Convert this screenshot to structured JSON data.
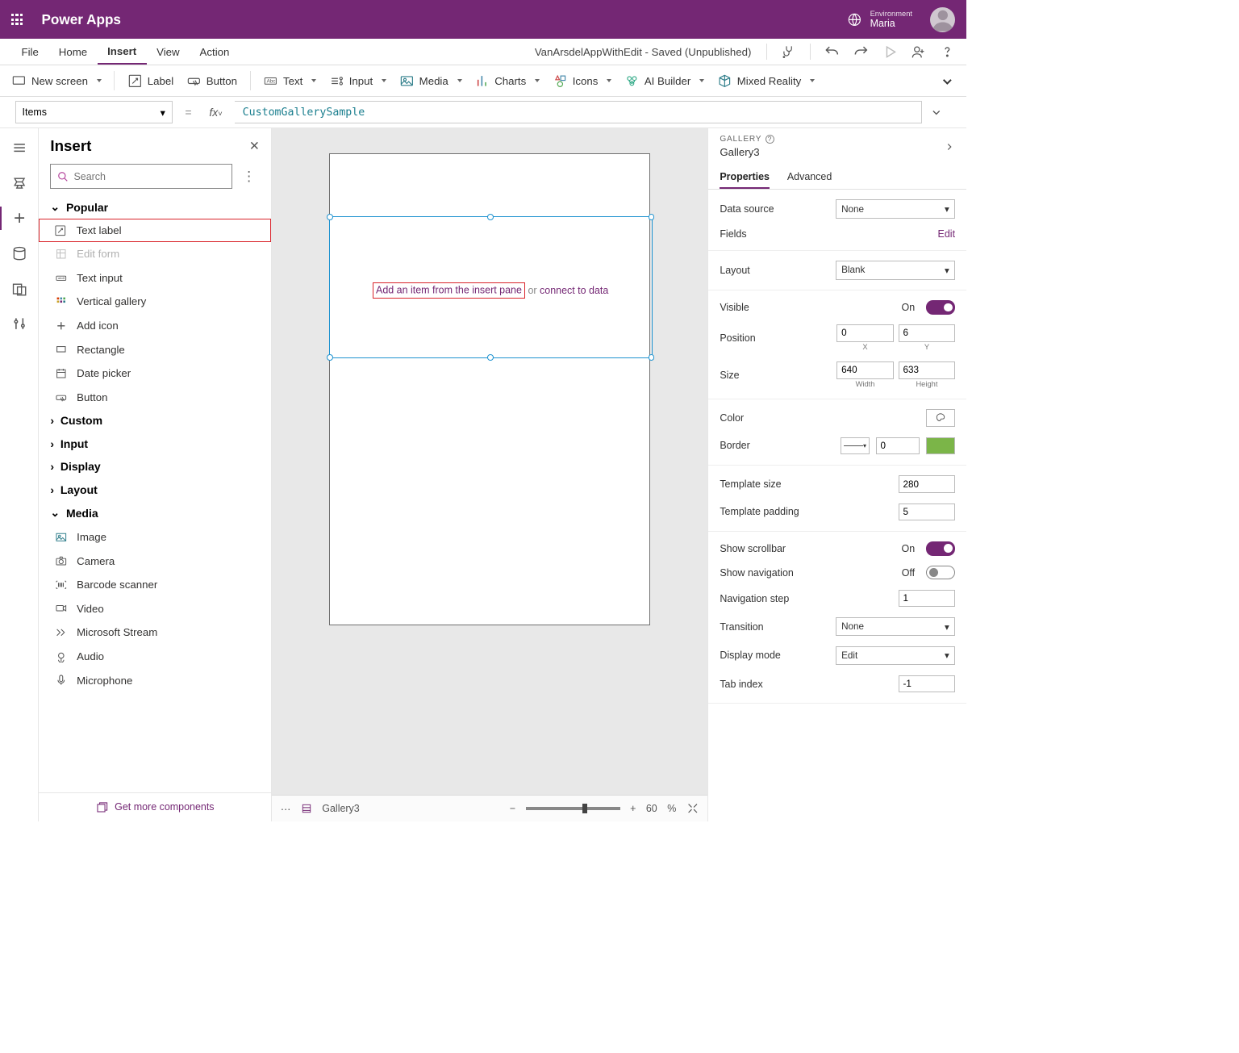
{
  "title_bar": {
    "brand": "Power Apps",
    "env_label": "Environment",
    "env_name": "Maria"
  },
  "menubar": {
    "items": [
      "File",
      "Home",
      "Insert",
      "View",
      "Action"
    ],
    "selected": "Insert",
    "app_title": "VanArsdelAppWithEdit - Saved (Unpublished)"
  },
  "ribbon": {
    "new_screen": "New screen",
    "label": "Label",
    "button": "Button",
    "text": "Text",
    "input": "Input",
    "media": "Media",
    "charts": "Charts",
    "icons": "Icons",
    "ai_builder": "AI Builder",
    "mixed_reality": "Mixed Reality"
  },
  "fxbar": {
    "property": "Items",
    "formula": "CustomGallerySample"
  },
  "insert_pane": {
    "title": "Insert",
    "search_placeholder": "Search",
    "groups": [
      {
        "label": "Popular",
        "open": true,
        "items": [
          {
            "label": "Text label",
            "icon": "text-label",
            "highlight": true
          },
          {
            "label": "Edit form",
            "icon": "form",
            "disabled": true
          },
          {
            "label": "Text input",
            "icon": "text-input"
          },
          {
            "label": "Vertical gallery",
            "icon": "gallery"
          },
          {
            "label": "Add icon",
            "icon": "plus"
          },
          {
            "label": "Rectangle",
            "icon": "rect"
          },
          {
            "label": "Date picker",
            "icon": "calendar"
          },
          {
            "label": "Button",
            "icon": "button"
          }
        ]
      },
      {
        "label": "Custom",
        "open": false
      },
      {
        "label": "Input",
        "open": false
      },
      {
        "label": "Display",
        "open": false
      },
      {
        "label": "Layout",
        "open": false
      },
      {
        "label": "Media",
        "open": true,
        "items": [
          {
            "label": "Image",
            "icon": "image"
          },
          {
            "label": "Camera",
            "icon": "camera"
          },
          {
            "label": "Barcode scanner",
            "icon": "barcode"
          },
          {
            "label": "Video",
            "icon": "video"
          },
          {
            "label": "Microsoft Stream",
            "icon": "stream"
          },
          {
            "label": "Audio",
            "icon": "audio"
          },
          {
            "label": "Microphone",
            "icon": "mic"
          }
        ]
      }
    ],
    "get_more": "Get more components"
  },
  "canvas": {
    "empty_insert": "Add an item from the insert pane",
    "empty_or": " or ",
    "empty_connect": "connect to data",
    "footer_element": "Gallery3",
    "zoom": "60",
    "zoom_pct": "%"
  },
  "props": {
    "cat": "GALLERY",
    "name": "Gallery3",
    "tabs": [
      "Properties",
      "Advanced"
    ],
    "data_source": {
      "label": "Data source",
      "value": "None"
    },
    "fields": {
      "label": "Fields",
      "action": "Edit"
    },
    "layout": {
      "label": "Layout",
      "value": "Blank"
    },
    "visible": {
      "label": "Visible",
      "value": "On"
    },
    "position": {
      "label": "Position",
      "x": "0",
      "y": "6",
      "xl": "X",
      "yl": "Y"
    },
    "size": {
      "label": "Size",
      "w": "640",
      "h": "633",
      "wl": "Width",
      "hl": "Height"
    },
    "color": {
      "label": "Color"
    },
    "border": {
      "label": "Border",
      "width": "0"
    },
    "tpl_size": {
      "label": "Template size",
      "value": "280"
    },
    "tpl_pad": {
      "label": "Template padding",
      "value": "5"
    },
    "scrollbar": {
      "label": "Show scrollbar",
      "value": "On"
    },
    "shownav": {
      "label": "Show navigation",
      "value": "Off"
    },
    "navstep": {
      "label": "Navigation step",
      "value": "1"
    },
    "transition": {
      "label": "Transition",
      "value": "None"
    },
    "displaymode": {
      "label": "Display mode",
      "value": "Edit"
    },
    "tabindex": {
      "label": "Tab index",
      "value": "-1"
    }
  }
}
